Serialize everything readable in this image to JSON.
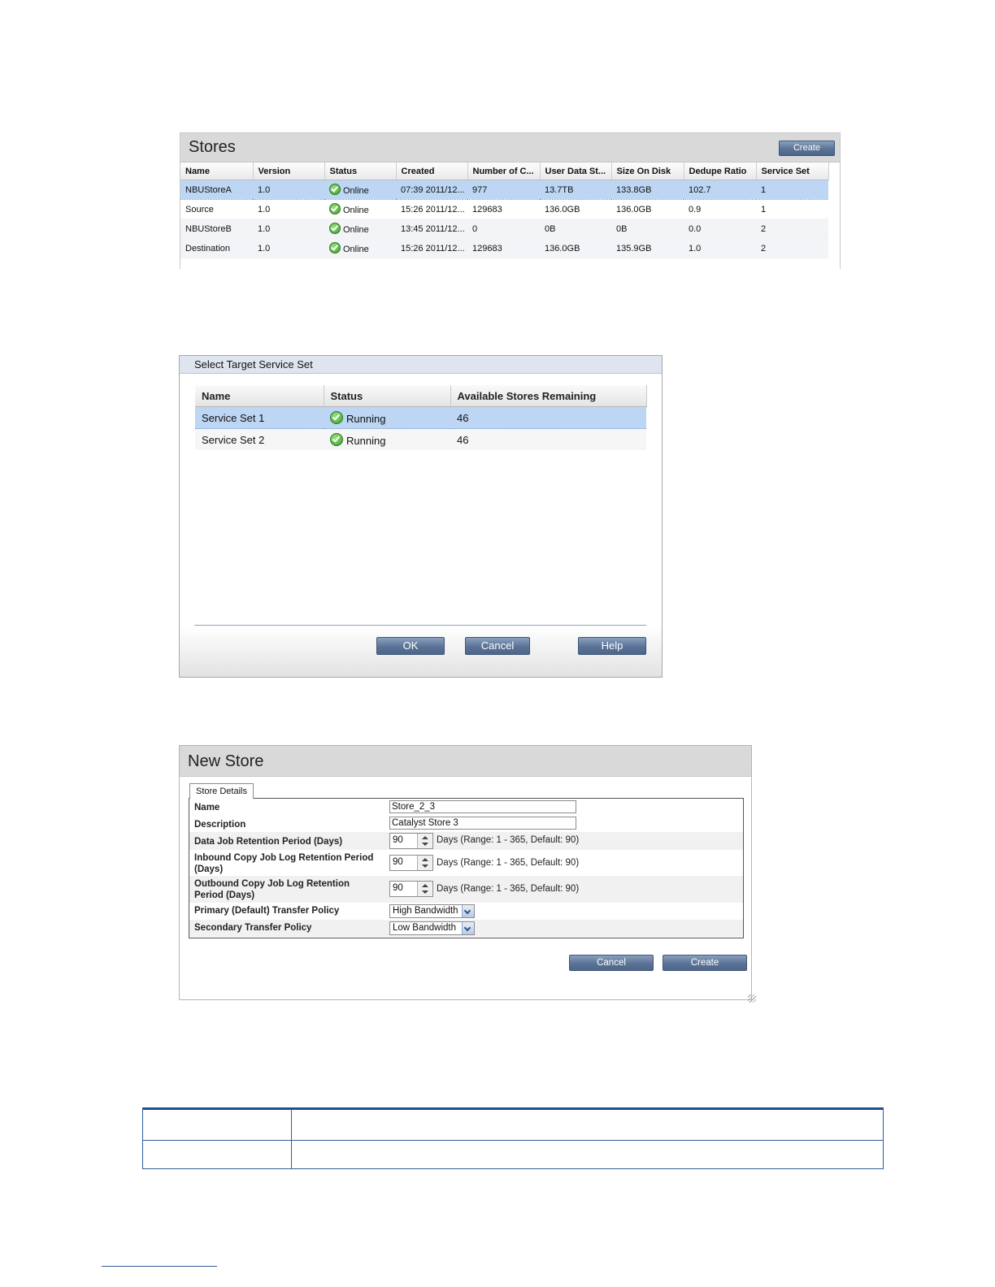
{
  "stores": {
    "title": "Stores",
    "create_label": "Create",
    "columns": [
      "Name",
      "Version",
      "Status",
      "Created",
      "Number of C...",
      "User Data St...",
      "Size On Disk",
      "Dedupe Ratio",
      "Service Set"
    ],
    "rows": [
      [
        "NBUStoreA",
        "1.0",
        "Online",
        "07:39 2011/12...",
        "977",
        "13.7TB",
        "133.8GB",
        "102.7",
        "1"
      ],
      [
        "Source",
        "1.0",
        "Online",
        "15:26 2011/12...",
        "129683",
        "136.0GB",
        "136.0GB",
        "0.9",
        "1"
      ],
      [
        "NBUStoreB",
        "1.0",
        "Online",
        "13:45 2011/12...",
        "0",
        "0B",
        "0B",
        "0.0",
        "2"
      ],
      [
        "Destination",
        "1.0",
        "Online",
        "15:26 2011/12...",
        "129683",
        "136.0GB",
        "135.9GB",
        "1.0",
        "2"
      ]
    ],
    "selected_row": 0
  },
  "service_set_dialog": {
    "title": "Select Target Service Set",
    "columns": [
      "Name",
      "Status",
      "Available Stores Remaining"
    ],
    "rows": [
      [
        "Service Set 1",
        "Running",
        "46"
      ],
      [
        "Service Set 2",
        "Running",
        "46"
      ]
    ],
    "selected_row": 0,
    "ok_label": "OK",
    "cancel_label": "Cancel",
    "help_label": "Help"
  },
  "new_store": {
    "title": "New Store",
    "tab_label": "Store Details",
    "name_label": "Name",
    "name_value": "Store_2_3",
    "description_label": "Description",
    "description_value": "Catalyst Store 3",
    "data_job_label": "Data Job Retention Period (Days)",
    "data_job_value": "90",
    "data_job_hint": "Days (Range: 1 - 365, Default: 90)",
    "inbound_label_line1": "Inbound Copy Job Log Retention Period",
    "inbound_label_line2": "(Days)",
    "inbound_value": "90",
    "inbound_hint": "Days (Range: 1 - 365, Default: 90)",
    "outbound_label_line1": "Outbound Copy Job Log Retention",
    "outbound_label_line2": "Period (Days)",
    "outbound_value": "90",
    "outbound_hint": "Days (Range: 1 - 365, Default: 90)",
    "primary_policy_label": "Primary (Default) Transfer Policy",
    "primary_policy_value": "High Bandwidth",
    "secondary_policy_label": "Secondary Transfer Policy",
    "secondary_policy_value": "Low Bandwidth",
    "cancel_label": "Cancel",
    "create_label": "Create"
  },
  "colors": {
    "selection": "#bcd6f3",
    "button": "#5b7397",
    "status_ok": "#3a9a2a"
  }
}
